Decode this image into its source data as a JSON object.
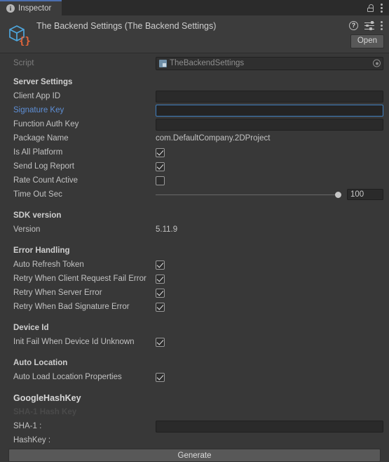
{
  "window": {
    "tab_label": "Inspector",
    "tab_icon": "info-icon",
    "lock_icon": "lock-icon",
    "menu_icon": "kebab-menu-icon"
  },
  "header": {
    "title": "The Backend Settings (The Backend Settings)",
    "asset_icon": "scriptable-object-cube-icon",
    "help_icon": "help-icon",
    "preset_icon": "preset-settings-icon",
    "menu_icon": "kebab-menu-icon",
    "open_label": "Open"
  },
  "script": {
    "label": "Script",
    "value": "TheBackendSettings",
    "chip_icon": "cs-script-icon",
    "picker_icon": "object-picker-icon"
  },
  "sections": {
    "server": {
      "title": "Server Settings",
      "client_app_id": {
        "label": "Client App ID",
        "value": ""
      },
      "signature_key": {
        "label": "Signature Key",
        "value": ""
      },
      "function_auth_key": {
        "label": "Function Auth Key",
        "value": ""
      },
      "package_name": {
        "label": "Package Name",
        "value": "com.DefaultCompany.2DProject"
      },
      "is_all_platform": {
        "label": "Is All Platform",
        "checked": true
      },
      "send_log_report": {
        "label": "Send Log Report",
        "checked": true
      },
      "rate_count_active": {
        "label": "Rate Count Active",
        "checked": false
      },
      "time_out_sec": {
        "label": "Time Out Sec",
        "value": "100",
        "min": 0,
        "max": 100
      }
    },
    "sdk": {
      "title": "SDK version",
      "version": {
        "label": "Version",
        "value": "5.11.9"
      }
    },
    "error_handling": {
      "title": "Error Handling",
      "items": [
        {
          "label": "Auto Refresh Token",
          "checked": true
        },
        {
          "label": "Retry When Client Request Fail Error",
          "checked": true
        },
        {
          "label": "Retry When Server Error",
          "checked": true
        },
        {
          "label": "Retry When Bad Signature Error",
          "checked": true
        }
      ]
    },
    "device_id": {
      "title": "Device Id",
      "items": [
        {
          "label": "Init Fail When Device Id Unknown",
          "checked": true
        }
      ]
    },
    "auto_location": {
      "title": "Auto Location",
      "items": [
        {
          "label": "Auto Load Location Properties",
          "checked": true
        }
      ]
    },
    "google_hash_key": {
      "title": "GoogleHashKey",
      "subtitle": "SHA-1 Hash Key",
      "sha1": {
        "label": "SHA-1 :",
        "value": ""
      },
      "hashkey": {
        "label": "HashKey :",
        "value": ""
      },
      "generate_label": "Generate"
    }
  },
  "colors": {
    "background": "#383838",
    "header": "#3c3c3c",
    "tabbar": "#2b2b2b",
    "accent_blue": "#5e8fd6",
    "focus_border": "#3f7fbf",
    "tab_top_border": "#4b6eaf"
  }
}
